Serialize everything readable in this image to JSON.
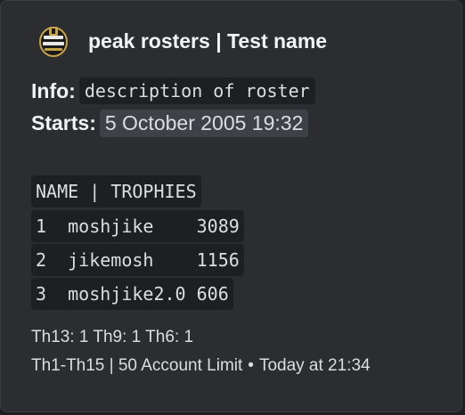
{
  "author": {
    "icon": "shield-badge-icon",
    "name": "peak rosters | Test name"
  },
  "fields": {
    "info_label": "Info:",
    "info_value": "description of roster",
    "starts_label": "Starts:",
    "starts_value": "5 October 2005 19:32"
  },
  "roster": {
    "header": "NAME | TROPHIES",
    "rows": [
      "1  moshjike    3089",
      "2  jikemosh    1156",
      "3  moshjike2.0 606"
    ]
  },
  "summary": "Th13: 1 Th9: 1 Th6: 1",
  "footer": {
    "text": "Th1-Th15 | 50 Account Limit",
    "separator": "•",
    "time": "Today at 21:34"
  },
  "colors": {
    "embed_background": "#2b2d31",
    "code_background": "#1e1f22",
    "timestamp_background": "#3f4148",
    "text": "#dbdee1",
    "heading": "#f2f3f5"
  }
}
